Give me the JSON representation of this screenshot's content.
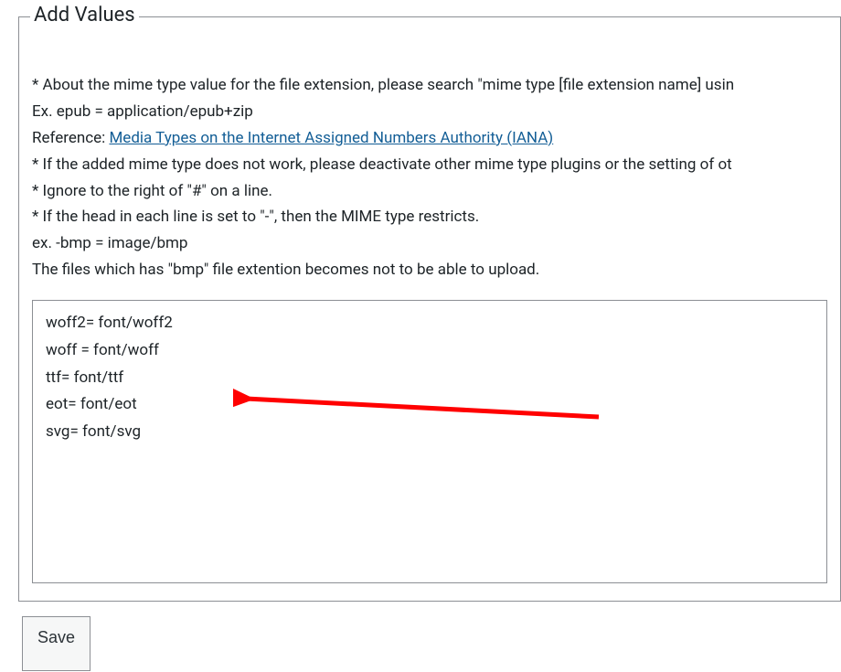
{
  "fieldset": {
    "legend": "Add Values"
  },
  "info": {
    "l1": "* About the mime type value for the file extension, please search \"mime type [file extension name] usin",
    "l2": "Ex. epub = application/epub+zip",
    "l3_prefix": "Reference: ",
    "l3_link": "Media Types on the Internet Assigned Numbers Authority (IANA)",
    "l4": "* If the added mime type does not work, please deactivate other mime type plugins or the setting of ot",
    "l5": "* Ignore to the right of \"#\" on a line.",
    "l6": "* If the head in each line is set to \"-\", then the MIME type restricts.",
    "l7": "ex. -bmp = image/bmp",
    "l8": "The files which has \"bmp\" file extention becomes not to be able to upload."
  },
  "textarea": {
    "value": "woff2= font/woff2\nwoff = font/woff\nttf= font/ttf\neot= font/eot\nsvg= font/svg"
  },
  "buttons": {
    "save": "Save"
  },
  "annotation": {
    "arrow": "red-arrow"
  }
}
